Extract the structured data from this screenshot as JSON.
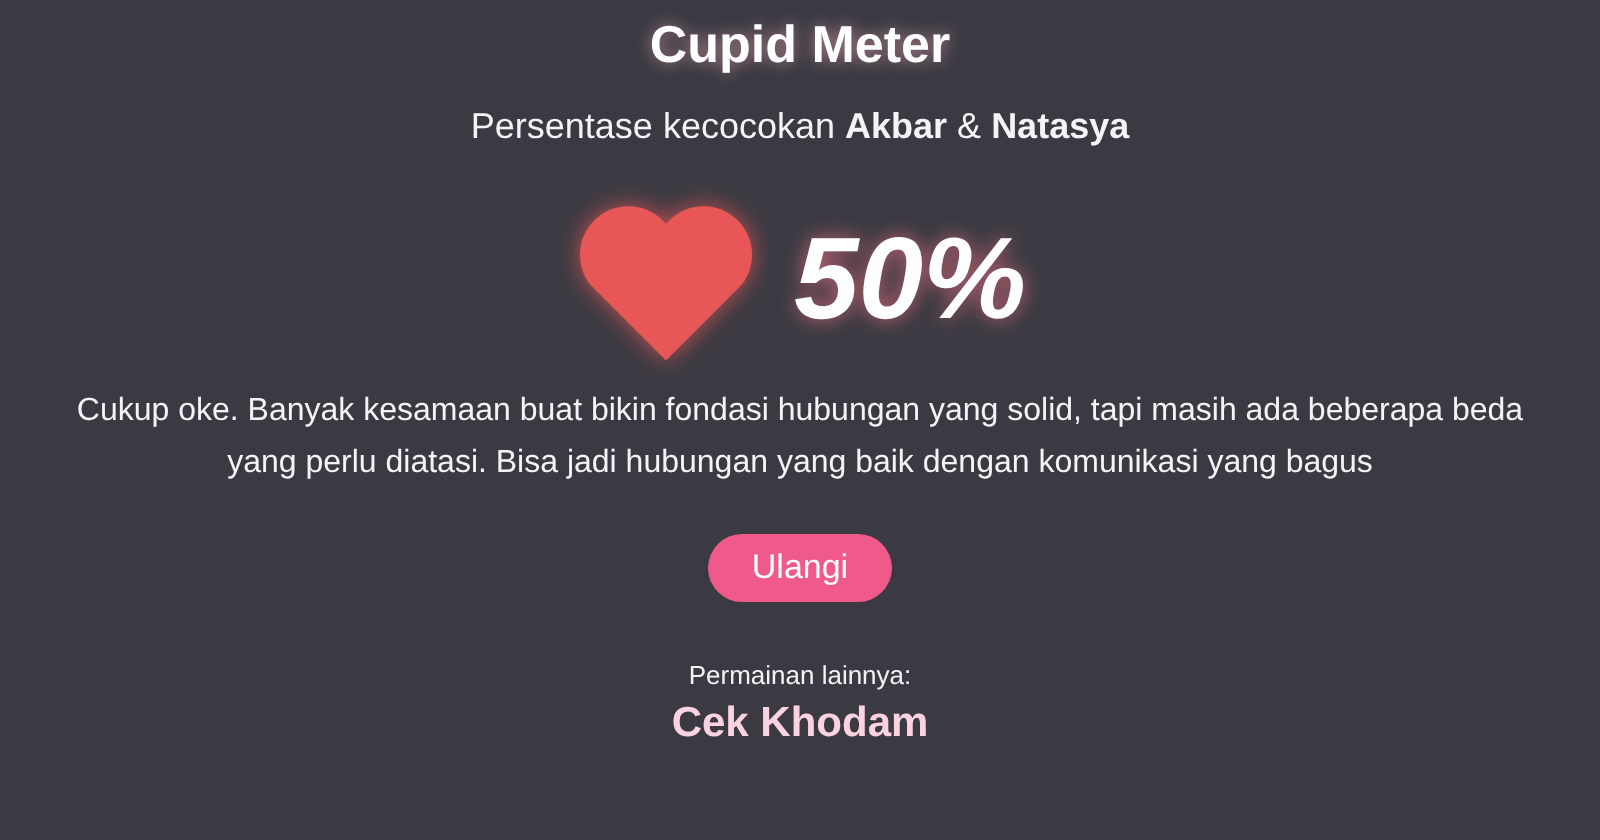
{
  "title": "Cupid Meter",
  "subtitle": "Persentase kecocokan **Akbar** & **Natasya**",
  "result": {
    "percent": "50%",
    "description": "Cukup oke. Banyak kesamaan buat bikin fondasi hubungan yang solid, tapi masih ada beberapa beda yang perlu diatasi. Bisa jadi hubungan yang baik dengan komunikasi yang bagus"
  },
  "button": "Ulangi",
  "other_games": {
    "label": "Permainan lainnya:",
    "link": "Cek Khodam"
  }
}
